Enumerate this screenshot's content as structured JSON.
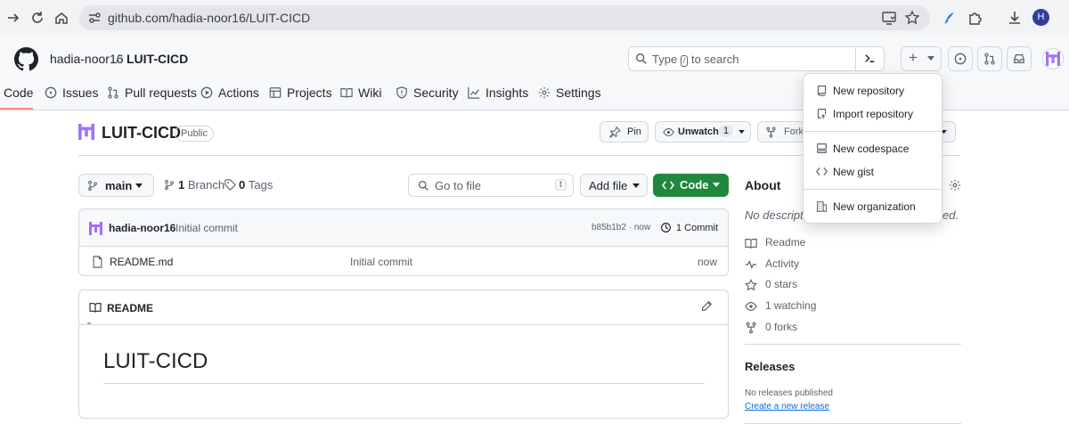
{
  "browser": {
    "url": "github.com/hadia-noor16/LUIT-CICD",
    "profile_initial": "H"
  },
  "header": {
    "owner": "hadia-noor16",
    "separator": "/",
    "repo": "LUIT-CICD",
    "search_prefix": "Type",
    "search_key": "/",
    "search_suffix": "to search",
    "plus_symbol": "+"
  },
  "tabs": [
    {
      "label": "Code",
      "icon": "code-icon"
    },
    {
      "label": "Issues",
      "icon": "issue-icon"
    },
    {
      "label": "Pull requests",
      "icon": "pull-request-icon"
    },
    {
      "label": "Actions",
      "icon": "play-icon"
    },
    {
      "label": "Projects",
      "icon": "table-icon"
    },
    {
      "label": "Wiki",
      "icon": "book-icon"
    },
    {
      "label": "Security",
      "icon": "shield-icon"
    },
    {
      "label": "Insights",
      "icon": "graph-icon"
    },
    {
      "label": "Settings",
      "icon": "gear-icon"
    }
  ],
  "repo_header": {
    "title": "LUIT-CICD",
    "visibility": "Public",
    "pin_label": "Pin",
    "unwatch_label": "Unwatch",
    "watch_count": "1",
    "fork_label": "Fork"
  },
  "toolbar": {
    "branch": "main",
    "branch_count": "1",
    "branch_label": "Branch",
    "tag_count": "0",
    "tag_label": "Tags",
    "go_to_file_placeholder": "Go to file",
    "go_to_file_key": "t",
    "add_file_label": "Add file",
    "code_label": "Code"
  },
  "latest_commit": {
    "author": "hadia-noor16",
    "message": "Initial commit",
    "sha_time": "b85b1b2 · now",
    "commit_count_label": "1 Commit"
  },
  "files": [
    {
      "name": "README.md",
      "commit_message": "Initial commit",
      "time": "now"
    }
  ],
  "readme": {
    "tab_label": "README",
    "heading": "LUIT-CICD"
  },
  "about": {
    "title": "About",
    "description_start": "No descripti",
    "description_end": "ed.",
    "items": [
      {
        "label": "Readme",
        "icon": "book-icon"
      },
      {
        "label": "Activity",
        "icon": "pulse-icon"
      },
      {
        "label": "0 stars",
        "icon": "star-icon"
      },
      {
        "label": "1 watching",
        "icon": "eye-icon"
      },
      {
        "label": "0 forks",
        "icon": "fork-icon"
      }
    ]
  },
  "releases": {
    "title": "Releases",
    "none_text": "No releases published",
    "create_link": "Create a new release"
  },
  "new_menu": {
    "items": [
      {
        "label": "New repository",
        "icon": "repo-icon"
      },
      {
        "label": "Import repository",
        "icon": "repo-push-icon"
      },
      {
        "label": "New codespace",
        "icon": "codespace-icon"
      },
      {
        "label": "New gist",
        "icon": "code-icon"
      },
      {
        "label": "New organization",
        "icon": "organization-icon"
      }
    ]
  },
  "colors": {
    "accent_green": "#1f883d",
    "link_blue": "#0969da",
    "tab_underline": "#fd8c73",
    "avatar_purple": "#a371f7"
  }
}
